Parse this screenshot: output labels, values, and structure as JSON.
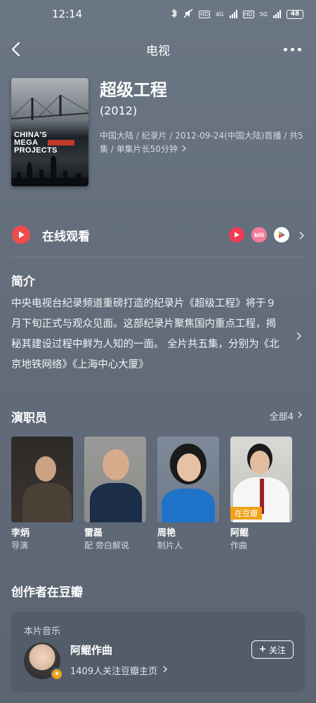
{
  "status": {
    "time": "12:14",
    "net_4g": "4G",
    "net_5g": "5G",
    "hd1": "HD",
    "hd2": "HD",
    "battery": "48"
  },
  "nav": {
    "title": "电视"
  },
  "show": {
    "title": "超级工程",
    "year": "(2012)",
    "meta": "中国大陆 / 纪录片 / 2012-09-24(中国大陆)首播 / 共5集 / 单集片长50分钟",
    "poster_text": "CHINA'S MEGA PROJECTS"
  },
  "watch": {
    "label": "在线观看",
    "platforms": [
      {
        "icon": "play-platform-icon",
        "color": "#ef3b53"
      },
      {
        "icon": "bilibili-platform-icon",
        "text": "bili",
        "color": "#f27c9a"
      },
      {
        "icon": "video-platform-icon",
        "color": "#ffffff"
      }
    ]
  },
  "intro": {
    "title": "简介",
    "text": "中央电视台纪录频道重磅打造的纪录片《超级工程》将于９月下旬正式与观众见面。这部纪录片聚焦国内重点工程，揭秘其建设过程中鲜为人知的一面。 全片共五集，分别为《北京地铁网络》《上海中心大厦》"
  },
  "cast": {
    "title": "演职员",
    "all_label": "全部4",
    "members": [
      {
        "name": "李炳",
        "role": "导演"
      },
      {
        "name": "雷磊",
        "role": "配 旁白解说"
      },
      {
        "name": "周艳",
        "role": "制片人"
      },
      {
        "name": "阿鲲",
        "role": "作曲",
        "tag": "在豆瓣"
      }
    ]
  },
  "creator": {
    "section_title": "创作者在豆瓣",
    "label": "本片音乐",
    "name": "阿鲲作曲",
    "sub": "1409人关注豆瓣主页",
    "follow": "关注"
  }
}
